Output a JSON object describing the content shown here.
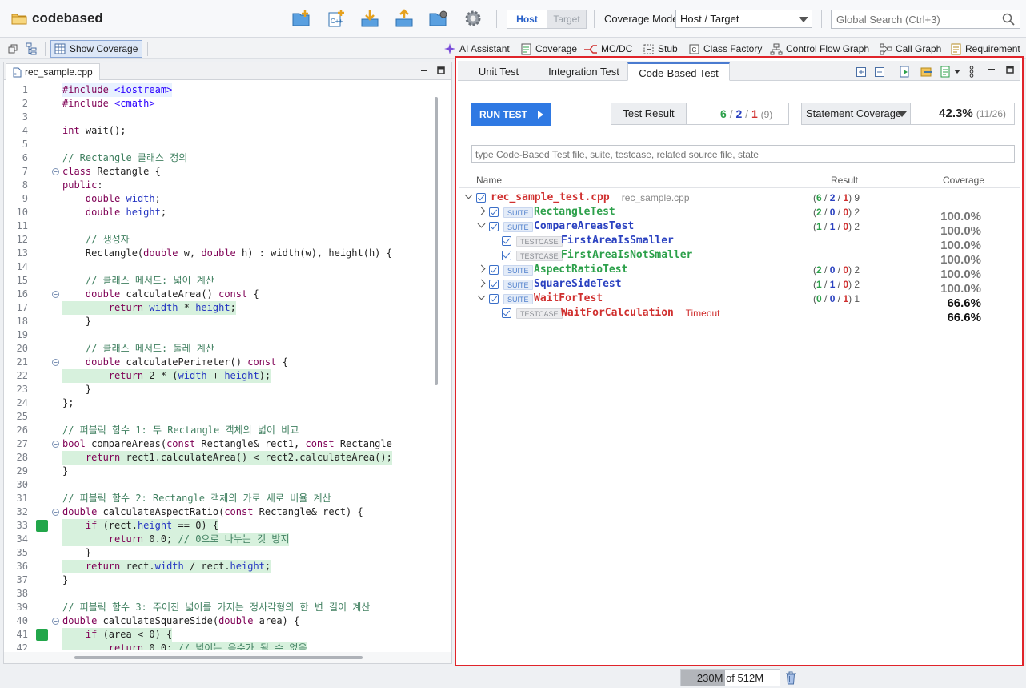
{
  "app": {
    "name": "codebased"
  },
  "topbar": {
    "host_label": "Host",
    "target_label": "Target",
    "coverage_mode_label": "Coverage Mode",
    "coverage_mode_value": "Host / Target",
    "search_placeholder": "Global Search (Ctrl+3)"
  },
  "toolbar2": {
    "show_coverage": "Show Coverage",
    "items": [
      "AI Assistant",
      "Coverage",
      "MC/DC",
      "Stub",
      "Class Factory",
      "Control Flow Graph",
      "Call Graph",
      "Requirement"
    ]
  },
  "editor": {
    "tab": "rec_sample.cpp",
    "lines": [
      {
        "n": "1",
        "t": "#include <iostream>",
        "hl": "blue"
      },
      {
        "n": "2",
        "t": "#include <cmath>"
      },
      {
        "n": "3",
        "t": ""
      },
      {
        "n": "4",
        "t": "int wait();"
      },
      {
        "n": "5",
        "t": ""
      },
      {
        "n": "6",
        "t": "// Rectangle 클래스 정의"
      },
      {
        "n": "7",
        "t": "class Rectangle {",
        "fold": true
      },
      {
        "n": "8",
        "t": "public:"
      },
      {
        "n": "9",
        "t": "    double width;"
      },
      {
        "n": "10",
        "t": "    double height;"
      },
      {
        "n": "11",
        "t": ""
      },
      {
        "n": "12",
        "t": "    // 생성자"
      },
      {
        "n": "13",
        "t": "    Rectangle(double w, double h) : width(w), height(h) {"
      },
      {
        "n": "14",
        "t": ""
      },
      {
        "n": "15",
        "t": "    // 클래스 메서드: 넓이 계산"
      },
      {
        "n": "16",
        "t": "    double calculateArea() const {",
        "fold": true
      },
      {
        "n": "17",
        "t": "        return width * height;",
        "hl": "green"
      },
      {
        "n": "18",
        "t": "    }"
      },
      {
        "n": "19",
        "t": ""
      },
      {
        "n": "20",
        "t": "    // 클래스 메서드: 둘레 계산"
      },
      {
        "n": "21",
        "t": "    double calculatePerimeter() const {",
        "fold": true
      },
      {
        "n": "22",
        "t": "        return 2 * (width + height);",
        "hl": "green"
      },
      {
        "n": "23",
        "t": "    }"
      },
      {
        "n": "24",
        "t": "};"
      },
      {
        "n": "25",
        "t": ""
      },
      {
        "n": "26",
        "t": "// 퍼블릭 함수 1: 두 Rectangle 객체의 넓이 비교"
      },
      {
        "n": "27",
        "t": "bool compareAreas(const Rectangle& rect1, const Rectangle",
        "fold": true
      },
      {
        "n": "28",
        "t": "    return rect1.calculateArea() < rect2.calculateArea();",
        "hl": "green"
      },
      {
        "n": "29",
        "t": "}"
      },
      {
        "n": "30",
        "t": ""
      },
      {
        "n": "31",
        "t": "// 퍼블릭 함수 2: Rectangle 객체의 가로 세로 비율 계산"
      },
      {
        "n": "32",
        "t": "double calculateAspectRatio(const Rectangle& rect) {",
        "fold": true
      },
      {
        "n": "33",
        "t": "    if (rect.height == 0) {",
        "hl": "green",
        "mark": true
      },
      {
        "n": "34",
        "t": "        return 0.0; // 0으로 나누는 것 방지",
        "hl": "green"
      },
      {
        "n": "35",
        "t": "    }"
      },
      {
        "n": "36",
        "t": "    return rect.width / rect.height;",
        "hl": "green"
      },
      {
        "n": "37",
        "t": "}"
      },
      {
        "n": "38",
        "t": ""
      },
      {
        "n": "39",
        "t": "// 퍼블릭 함수 3: 주어진 넓이를 가지는 정사각형의 한 변 길이 계산"
      },
      {
        "n": "40",
        "t": "double calculateSquareSide(double area) {",
        "fold": true
      },
      {
        "n": "41",
        "t": "    if (area < 0) {",
        "hl": "green",
        "mark": true
      },
      {
        "n": "42",
        "t": "        return 0.0; // 넓이는 음수가 될 수 없음",
        "hl": "green"
      }
    ]
  },
  "right_panel": {
    "tabs": [
      "Unit Test",
      "Integration Test",
      "Code-Based Test"
    ],
    "active_tab": "Code-Based Test",
    "run_test": "RUN TEST",
    "test_result_label": "Test Result",
    "test_result": {
      "pass": "6",
      "fail": "2",
      "error": "1",
      "total": "(9)"
    },
    "coverage_select": "Statement Coverage",
    "coverage_value": "42.3%",
    "coverage_detail": "(11/26)",
    "filter_placeholder": "type Code-Based Test file, suite, testcase, related source file, state",
    "columns": {
      "name": "Name",
      "result": "Result",
      "coverage": "Coverage"
    },
    "tree": [
      {
        "level": 0,
        "twisty": "open",
        "name": "rec_sample_test.cpp",
        "sub": "rec_sample.cpp",
        "cls": "fail",
        "res": [
          "6",
          "2",
          "1",
          "9"
        ],
        "cov": ""
      },
      {
        "level": 1,
        "twisty": "closed",
        "badge": "SUITE",
        "name": "RectangleTest",
        "cls": "pass",
        "res": [
          "2",
          "0",
          "0",
          "2"
        ],
        "cov": "100.0%"
      },
      {
        "level": 1,
        "twisty": "open",
        "badge": "SUITE",
        "name": "CompareAreasTest",
        "cls": "mixed",
        "res": [
          "1",
          "1",
          "0",
          "2"
        ],
        "cov": "100.0%"
      },
      {
        "level": 2,
        "badge": "TESTCASE",
        "name": "FirstAreaIsSmaller",
        "cls": "mixed",
        "cov": "100.0%"
      },
      {
        "level": 2,
        "badge": "TESTCASE",
        "name": "FirstAreaIsNotSmaller",
        "cls": "pass",
        "cov": "100.0%"
      },
      {
        "level": 1,
        "twisty": "closed",
        "badge": "SUITE",
        "name": "AspectRatioTest",
        "cls": "pass",
        "res": [
          "2",
          "0",
          "0",
          "2"
        ],
        "cov": "100.0%"
      },
      {
        "level": 1,
        "twisty": "closed",
        "badge": "SUITE",
        "name": "SquareSideTest",
        "cls": "mixed",
        "res": [
          "1",
          "1",
          "0",
          "2"
        ],
        "cov": "100.0%"
      },
      {
        "level": 1,
        "twisty": "open",
        "badge": "SUITE",
        "name": "WaitForTest",
        "cls": "fail",
        "res": [
          "0",
          "0",
          "1",
          "1"
        ],
        "cov": "66.6%",
        "dark": true
      },
      {
        "level": 2,
        "badge": "TESTCASE",
        "name": "WaitForCalculation",
        "sub": "Timeout",
        "cls": "fail",
        "cov": "66.6%",
        "dark": true
      }
    ]
  },
  "status": {
    "memory_used": "230M",
    "memory_of": "of 512M",
    "memory_fraction": 0.45
  }
}
